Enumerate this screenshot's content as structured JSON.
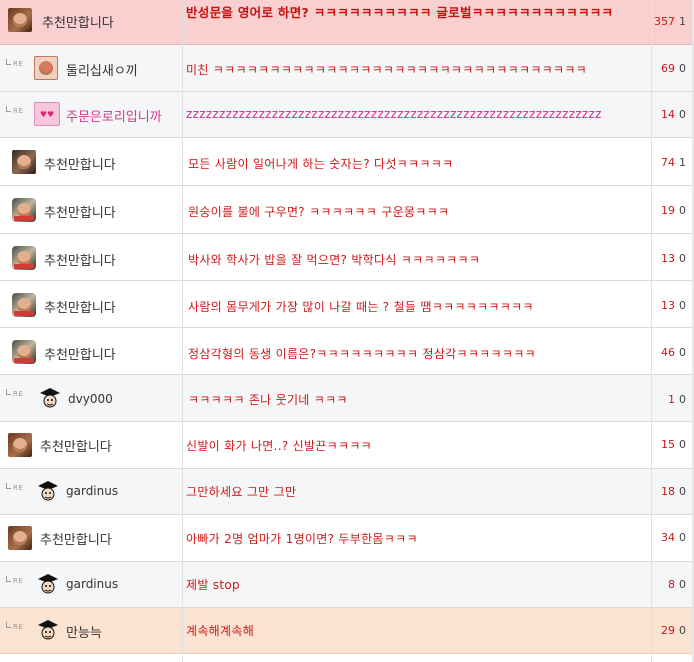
{
  "reply_label": "RE",
  "rows": [
    {
      "nick": "추천만합니다",
      "title": "반성문을 영어로 하면? ㅋㅋㅋㅋㅋㅋㅋㅋㅋㅋ 글로벌ㅋㅋㅋㅋㅋㅋㅋㅋㅋㅋㅋㅋ",
      "views": "357",
      "votes": "1",
      "avatar": "brown",
      "reply": false
    },
    {
      "nick": "둘리십새ㅇ끼",
      "title": "미친 ㅋㅋㅋㅋㅋㅋㅋㅋㅋㅋㅋㅋㅋㅋㅋㅋㅋㅋㅋㅋㅋㅋㅋㅋㅋㅋㅋㅋㅋㅋㅋㅋㅋ",
      "views": "69",
      "votes": "0",
      "avatar": "redface",
      "reply": true
    },
    {
      "nick": "주문은로리입니까",
      "title": "zzzzzzzzzzzzzzzzzzzzzzzzzzzzzzzzzzzzzzzzzzzzzzzzzzzzzzzzzzzzzzz",
      "views": "14",
      "votes": "0",
      "avatar": "pink",
      "reply": true
    },
    {
      "nick": "추천만합니다",
      "title": "모든 사람이 일어나게 하는 숫자는? 다섯ㅋㅋㅋㅋㅋ",
      "views": "74",
      "votes": "1",
      "avatar": "dark",
      "reply": false
    },
    {
      "nick": "추천만합니다",
      "title": "원숭이를 불에 구우면? ㅋㅋㅋㅋㅋㅋ 구운몽ㅋㅋㅋ",
      "views": "19",
      "votes": "0",
      "avatar": "warrior",
      "reply": false
    },
    {
      "nick": "추천만합니다",
      "title": "박사와 학사가 밥을 잘 먹으면? 박학다식 ㅋㅋㅋㅋㅋㅋㅋ",
      "views": "13",
      "votes": "0",
      "avatar": "warrior",
      "reply": false
    },
    {
      "nick": "추천만합니다",
      "title": "사람의 몸무게가 가장 많이 나갈 때는 ? 철들 땜ㅋㅋㅋㅋㅋㅋㅋㅋㅋ",
      "views": "13",
      "votes": "0",
      "avatar": "warrior",
      "reply": false
    },
    {
      "nick": "추천만합니다",
      "title": "정삼각형의 동생 이름은?ㅋㅋㅋㅋㅋㅋㅋㅋㅋ 정삼각ㅋㅋㅋㅋㅋㅋㅋ",
      "views": "46",
      "votes": "0",
      "avatar": "warrior",
      "reply": false
    },
    {
      "nick": "dvy000",
      "title": "ㅋㅋㅋㅋㅋ 존나 웃기네 ㅋㅋㅋ",
      "views": "1",
      "votes": "0",
      "avatar": "doctor",
      "reply": true
    },
    {
      "nick": "추천만합니다",
      "title": "신발이 화가 나면..? 신발끈ㅋㅋㅋㅋ",
      "views": "15",
      "votes": "0",
      "avatar": "brown",
      "reply": false
    },
    {
      "nick": "gardinus",
      "title": "그만하세요 그만 그만",
      "views": "18",
      "votes": "0",
      "avatar": "doctor",
      "reply": true
    },
    {
      "nick": "추천만합니다",
      "title": "아빠가 2명 엄마가 1명이면? 두부한몸ㅋㅋㅋ",
      "views": "34",
      "votes": "0",
      "avatar": "brown",
      "reply": false
    },
    {
      "nick": "gardinus",
      "title": "제발 stop",
      "views": "8",
      "votes": "0",
      "avatar": "doctor",
      "reply": true
    },
    {
      "nick": "만능늑",
      "title": "계속해계속해",
      "views": "29",
      "votes": "0",
      "avatar": "doctor",
      "reply": true
    }
  ],
  "colors": {
    "title_red": "#d01818",
    "title_magenta": "#d2298f",
    "highlight_top": "#f9cfcf",
    "highlight_bottom": "#fbe3d2",
    "alt_row": "#f5f6f8"
  }
}
